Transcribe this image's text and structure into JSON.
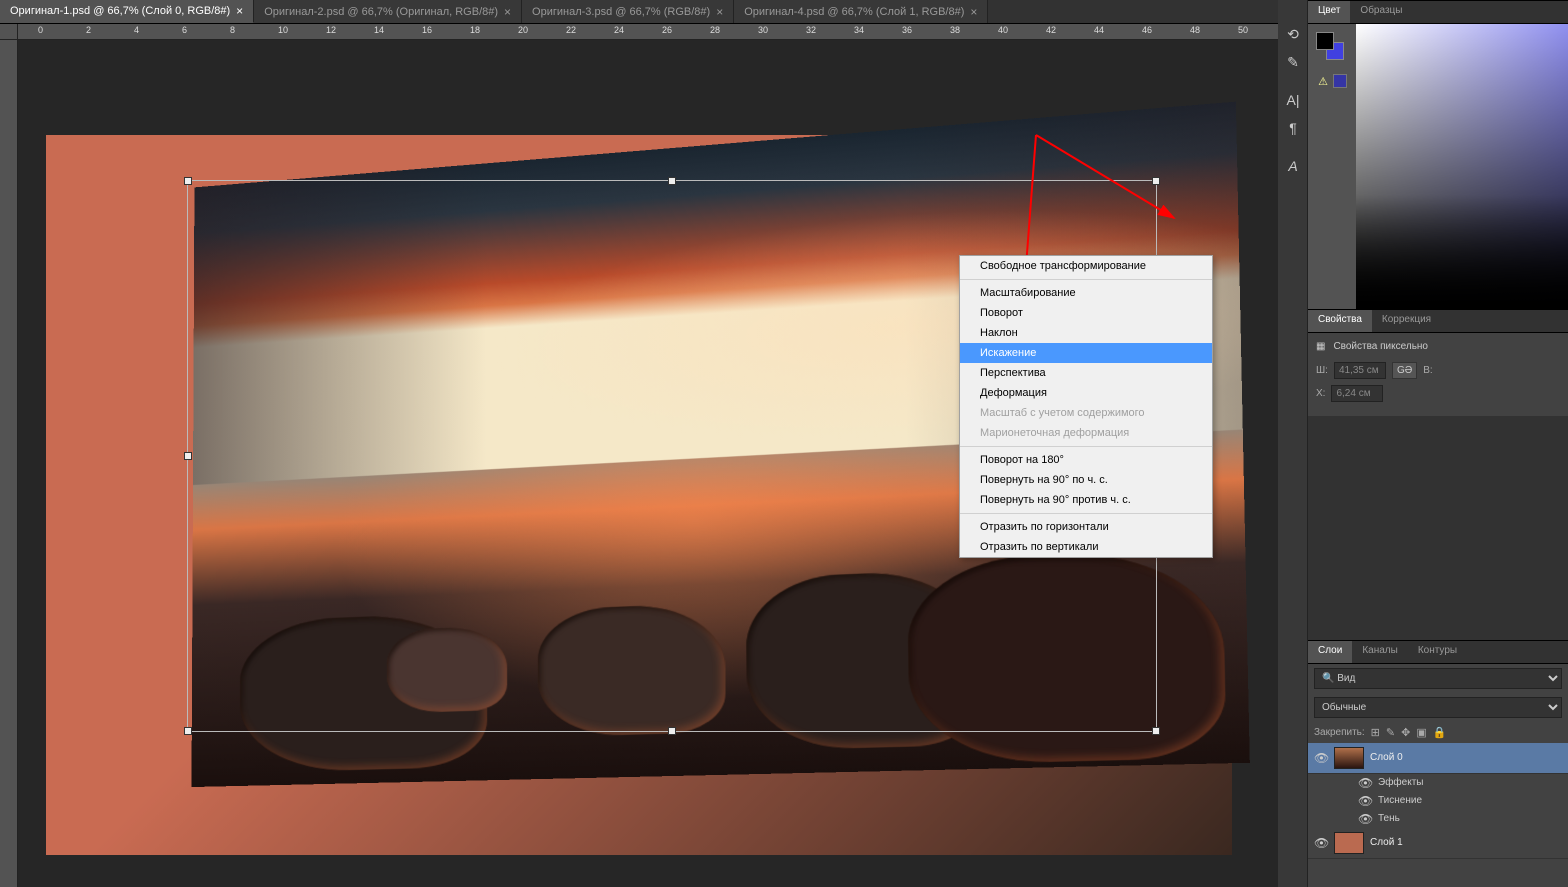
{
  "tabs": [
    {
      "label": "Оригинал-1.psd @ 66,7% (Слой 0, RGB/8#)",
      "active": true
    },
    {
      "label": "Оригинал-2.psd @ 66,7% (Оригинал, RGB/8#)",
      "active": false
    },
    {
      "label": "Оригинал-3.psd @ 66,7% (RGB/8#)",
      "active": false
    },
    {
      "label": "Оригинал-4.psd @ 66,7% (Слой 1, RGB/8#)",
      "active": false
    }
  ],
  "ruler_marks": [
    "0",
    "2",
    "4",
    "6",
    "8",
    "10",
    "12",
    "14",
    "16",
    "18",
    "20",
    "22",
    "24",
    "26",
    "28",
    "30",
    "32",
    "34",
    "36",
    "38",
    "40",
    "42",
    "44",
    "46",
    "48",
    "50"
  ],
  "context_menu": {
    "items": [
      {
        "label": "Свободное трансформирование",
        "type": "item"
      },
      {
        "type": "sep"
      },
      {
        "label": "Масштабирование",
        "type": "item"
      },
      {
        "label": "Поворот",
        "type": "item"
      },
      {
        "label": "Наклон",
        "type": "item"
      },
      {
        "label": "Искажение",
        "type": "item",
        "selected": true
      },
      {
        "label": "Перспектива",
        "type": "item"
      },
      {
        "label": "Деформация",
        "type": "item"
      },
      {
        "label": "Масштаб с учетом содержимого",
        "type": "item",
        "disabled": true
      },
      {
        "label": "Марионеточная деформация",
        "type": "item",
        "disabled": true
      },
      {
        "type": "sep"
      },
      {
        "label": "Поворот на 180°",
        "type": "item"
      },
      {
        "label": "Повернуть на 90° по ч. с.",
        "type": "item"
      },
      {
        "label": "Повернуть на 90° против ч. с.",
        "type": "item"
      },
      {
        "type": "sep"
      },
      {
        "label": "Отразить по горизонтали",
        "type": "item"
      },
      {
        "label": "Отразить по вертикали",
        "type": "item"
      }
    ]
  },
  "color_tabs": {
    "color": "Цвет",
    "swatches": "Образцы"
  },
  "props_tabs": {
    "props": "Свойства",
    "corr": "Коррекция"
  },
  "props": {
    "header": "Свойства пиксельно",
    "w_label": "Ш:",
    "w_value": "41,35 см",
    "h_label": "В:",
    "x_label": "X:",
    "x_value": "6,24 см",
    "link": "GƏ"
  },
  "layers_tabs": {
    "layers": "Слои",
    "channels": "Каналы",
    "paths": "Контуры"
  },
  "layers": {
    "filter_label": "Вид",
    "blend_label": "Обычные",
    "lock_label": "Закрепить:",
    "items": [
      {
        "name": "Слой 0",
        "thumb": "photo",
        "selected": true,
        "fx": [
          {
            "name": "Эффекты"
          },
          {
            "name": "Тиснение"
          },
          {
            "name": "Тень"
          }
        ]
      },
      {
        "name": "Слой 1",
        "thumb": "solid"
      }
    ]
  }
}
